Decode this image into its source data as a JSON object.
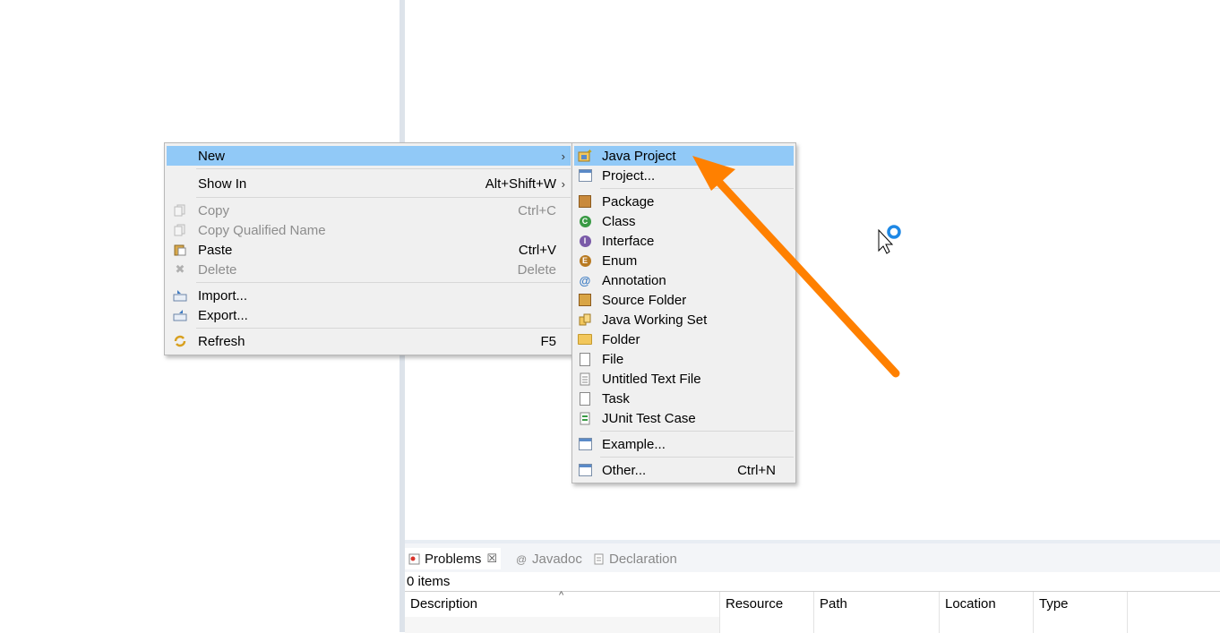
{
  "context_menu": {
    "items": [
      {
        "label": "New",
        "accel": "",
        "has_submenu": true
      },
      {
        "label": "Show In",
        "accel": "Alt+Shift+W",
        "has_submenu": true
      },
      {
        "label": "Copy",
        "accel": "Ctrl+C"
      },
      {
        "label": "Copy Qualified Name",
        "accel": ""
      },
      {
        "label": "Paste",
        "accel": "Ctrl+V"
      },
      {
        "label": "Delete",
        "accel": "Delete"
      },
      {
        "label": "Import...",
        "accel": ""
      },
      {
        "label": "Export...",
        "accel": ""
      },
      {
        "label": "Refresh",
        "accel": "F5"
      }
    ],
    "arrow_glyph": "›"
  },
  "new_submenu": {
    "items": [
      {
        "label": "Java Project"
      },
      {
        "label": "Project..."
      },
      {
        "label": "Package"
      },
      {
        "label": "Class"
      },
      {
        "label": "Interface"
      },
      {
        "label": "Enum"
      },
      {
        "label": "Annotation"
      },
      {
        "label": "Source Folder"
      },
      {
        "label": "Java Working Set"
      },
      {
        "label": "Folder"
      },
      {
        "label": "File"
      },
      {
        "label": "Untitled Text File"
      },
      {
        "label": "Task"
      },
      {
        "label": "JUnit Test Case"
      },
      {
        "label": "Example..."
      },
      {
        "label": "Other...",
        "accel": "Ctrl+N"
      }
    ]
  },
  "problems_view": {
    "tabs": [
      "Problems",
      "Javadoc",
      "Declaration"
    ],
    "close_glyph": "☒",
    "items_count": "0 items",
    "columns": [
      "Description",
      "Resource",
      "Path",
      "Location",
      "Type"
    ]
  },
  "colors": {
    "highlight": "#91c9f7",
    "annotation_arrow": "#ff8000",
    "busy_cursor": "#1e88e5"
  }
}
